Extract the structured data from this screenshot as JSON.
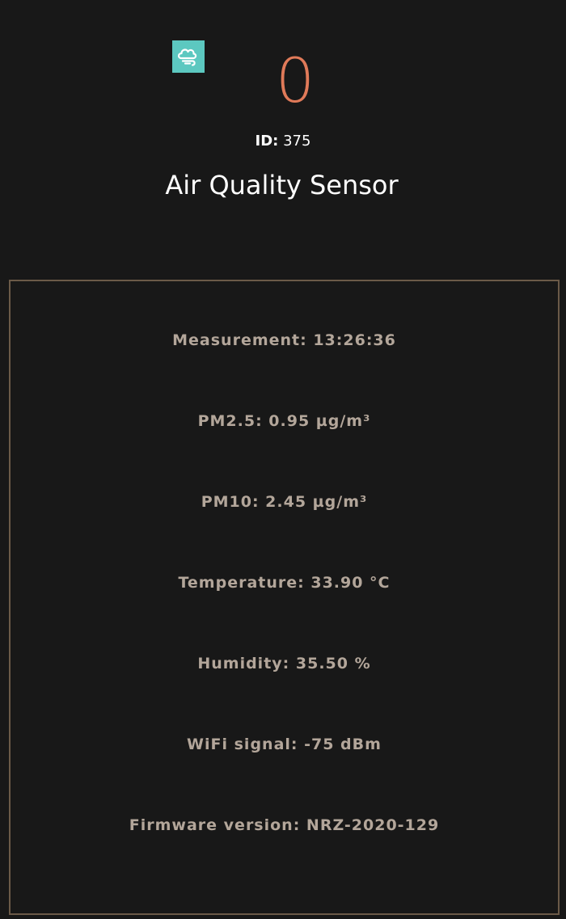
{
  "device": {
    "icon": "cloud-wind-icon",
    "icon_color": "#5cc8c0",
    "value": "0",
    "value_color": "#e07a59",
    "id_label": "ID:",
    "id_value": "375",
    "title": "Air Quality Sensor"
  },
  "details": [
    {
      "label": "Measurement: 13:26:36"
    },
    {
      "label": "PM2.5: 0.95 µg/m³"
    },
    {
      "label": "PM10: 2.45 µg/m³"
    },
    {
      "label": "Temperature: 33.90 °C"
    },
    {
      "label": "Humidity: 35.50 %"
    },
    {
      "label": "WiFi signal: -75 dBm"
    },
    {
      "label": "Firmware version: NRZ-2020-129"
    }
  ]
}
